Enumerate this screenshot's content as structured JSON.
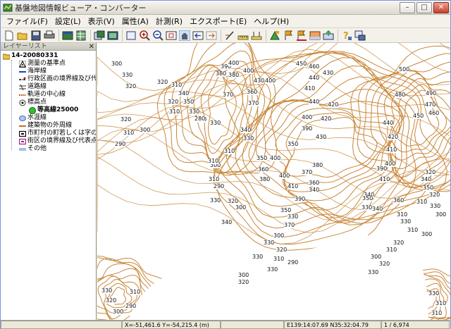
{
  "window": {
    "title": "基盤地図情報ビューア・コンバーター",
    "minimize": "–",
    "maximize": "□",
    "close": "✕"
  },
  "menu": [
    "ファイル(F)",
    "設定(L)",
    "表示(V)",
    "属性(A)",
    "計測(R)",
    "エクスポート(E)",
    "ヘルプ(H)"
  ],
  "toolbar_icons": [
    "new-icon",
    "open-icon",
    "save-icon",
    "print-icon",
    "layer-icon",
    "table-icon",
    "copy-icon",
    "image-icon",
    "zoom-full-icon",
    "zoom-in-icon",
    "zoom-out-icon",
    "zoom-box-icon",
    "pan-icon",
    "back-icon",
    "forward-icon",
    "measure-icon",
    "ruler-icon",
    "area-icon",
    "flag-icon",
    "flag2-icon",
    "flag3-icon",
    "chart-icon",
    "export-icon",
    "help-icon",
    "info-icon"
  ],
  "layers": {
    "panel_title": "レイヤーリスト",
    "close": "✕",
    "root": "14-20080331",
    "items": [
      {
        "label": "測量の基準点",
        "icon": "triangle-icon"
      },
      {
        "label": "海岸線",
        "icon": "line-icon"
      },
      {
        "label": "行政区画の境界線及び代...",
        "icon": "boundary-icon"
      },
      {
        "label": "道路線",
        "icon": "road-icon"
      },
      {
        "label": "軌道の中心線",
        "icon": "rail-icon"
      },
      {
        "label": "標高点",
        "icon": "elevation-point-icon"
      },
      {
        "label": "等高線25000",
        "icon": "contour-icon",
        "grand": true
      },
      {
        "label": "水涯線",
        "icon": "water-icon"
      },
      {
        "label": "建築物の外周線",
        "icon": "building-icon"
      },
      {
        "label": "市町村の町若しくは字の...",
        "icon": "town-icon"
      },
      {
        "label": "街区の境界線及び代表点",
        "icon": "block-icon"
      },
      {
        "label": "その他",
        "icon": "other-icon"
      }
    ]
  },
  "map": {
    "contour_color": "#c8873a",
    "labels": [
      {
        "t": "300"
      },
      {
        "t": "330"
      },
      {
        "t": "320"
      },
      {
        "t": "320"
      },
      {
        "t": "310"
      },
      {
        "t": "320"
      },
      {
        "t": "310"
      },
      {
        "t": "300"
      },
      {
        "t": "290"
      },
      {
        "t": "320"
      },
      {
        "t": "310"
      },
      {
        "t": "340"
      },
      {
        "t": "350"
      },
      {
        "t": "330"
      },
      {
        "t": "300"
      },
      {
        "t": "330"
      },
      {
        "t": "380"
      },
      {
        "t": "390"
      },
      {
        "t": "370"
      },
      {
        "t": "400"
      },
      {
        "t": "380"
      },
      {
        "t": "400"
      },
      {
        "t": "430"
      },
      {
        "t": "400"
      },
      {
        "t": "360"
      },
      {
        "t": "370"
      },
      {
        "t": "310"
      },
      {
        "t": "300"
      },
      {
        "t": "310"
      },
      {
        "t": "340"
      },
      {
        "t": "330"
      },
      {
        "t": "350"
      },
      {
        "t": "360"
      },
      {
        "t": "310"
      },
      {
        "t": "290"
      },
      {
        "t": "280"
      },
      {
        "t": "330"
      },
      {
        "t": "320"
      },
      {
        "t": "300"
      },
      {
        "t": "340"
      },
      {
        "t": "350"
      },
      {
        "t": "330"
      },
      {
        "t": "370"
      },
      {
        "t": "300"
      },
      {
        "t": "330"
      },
      {
        "t": "320"
      },
      {
        "t": "310"
      },
      {
        "t": "290"
      },
      {
        "t": "330"
      },
      {
        "t": "300"
      },
      {
        "t": "320"
      },
      {
        "t": "330"
      },
      {
        "t": "340"
      },
      {
        "t": "450"
      },
      {
        "t": "460"
      },
      {
        "t": "440"
      },
      {
        "t": "410"
      },
      {
        "t": "430"
      },
      {
        "t": "440"
      },
      {
        "t": "420"
      },
      {
        "t": "400"
      },
      {
        "t": "390"
      },
      {
        "t": "420"
      },
      {
        "t": "430"
      },
      {
        "t": "400"
      },
      {
        "t": "350"
      },
      {
        "t": "370"
      },
      {
        "t": "380"
      },
      {
        "t": "360"
      },
      {
        "t": "400"
      },
      {
        "t": "410"
      },
      {
        "t": "390"
      },
      {
        "t": "380"
      },
      {
        "t": "500"
      },
      {
        "t": "480"
      },
      {
        "t": "490"
      },
      {
        "t": "470"
      },
      {
        "t": "460"
      },
      {
        "t": "450"
      },
      {
        "t": "440"
      },
      {
        "t": "420"
      },
      {
        "t": "410"
      },
      {
        "t": "400"
      },
      {
        "t": "390"
      },
      {
        "t": "410"
      },
      {
        "t": "340"
      },
      {
        "t": "350"
      },
      {
        "t": "360"
      },
      {
        "t": "340"
      },
      {
        "t": "330"
      },
      {
        "t": "310"
      },
      {
        "t": "320"
      },
      {
        "t": "340"
      },
      {
        "t": "350"
      },
      {
        "t": "310"
      },
      {
        "t": "320"
      },
      {
        "t": "330"
      },
      {
        "t": "300"
      },
      {
        "t": "310"
      },
      {
        "t": "300"
      },
      {
        "t": "330"
      },
      {
        "t": "320"
      },
      {
        "t": "310"
      },
      {
        "t": "300"
      },
      {
        "t": "320"
      },
      {
        "t": "330"
      },
      {
        "t": "330"
      },
      {
        "t": "320"
      },
      {
        "t": "300"
      },
      {
        "t": "310"
      },
      {
        "t": "290"
      },
      {
        "t": "330"
      },
      {
        "t": "310"
      },
      {
        "t": "310"
      }
    ]
  },
  "status": {
    "empty": "",
    "xy": "X=-51,461.6 Y=-54,215.4 (m)",
    "latlon": "E139:14:07.69 N35:32:04.79",
    "scale": "1 / 6,974"
  }
}
